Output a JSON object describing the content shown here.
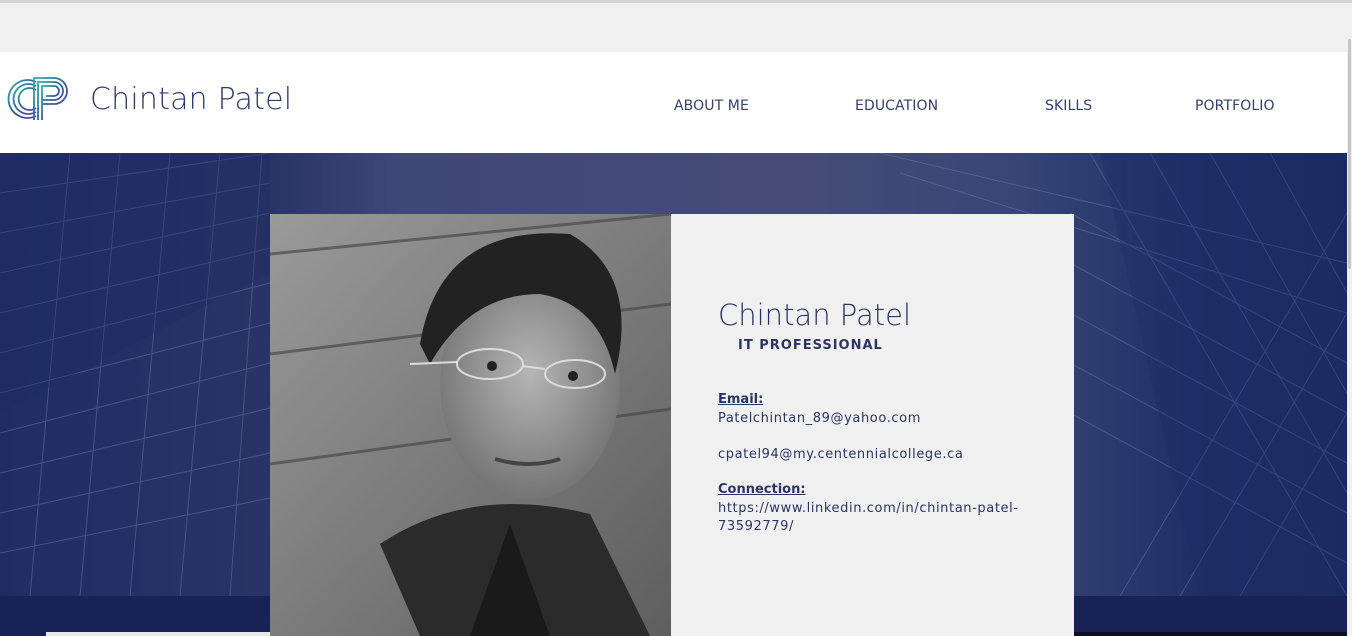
{
  "header": {
    "logo_text": "CP",
    "site_title": "Chintan Patel"
  },
  "nav": {
    "items": [
      {
        "label": "ABOUT ME"
      },
      {
        "label": "EDUCATION"
      },
      {
        "label": "SKILLS"
      },
      {
        "label": "PORTFOLIO"
      }
    ]
  },
  "profile": {
    "name": "Chintan Patel",
    "role": "IT PROFESSIONAL",
    "email_label": "Email:",
    "email_primary": "Patelchintan_89@yahoo.com",
    "email_secondary": "cpatel94@my.centennialcollege.ca",
    "connection_label": "Connection:",
    "connection_url_line1": "https://www.linkedin.com/in/chintan-patel-",
    "connection_url_line2": "73592779/"
  },
  "colors": {
    "brand_navy": "#2b3565",
    "hero_blue": "#1f2d64",
    "card_bg": "#f0f0f0"
  },
  "icons": {
    "logo": "cp-monogram-logo"
  }
}
